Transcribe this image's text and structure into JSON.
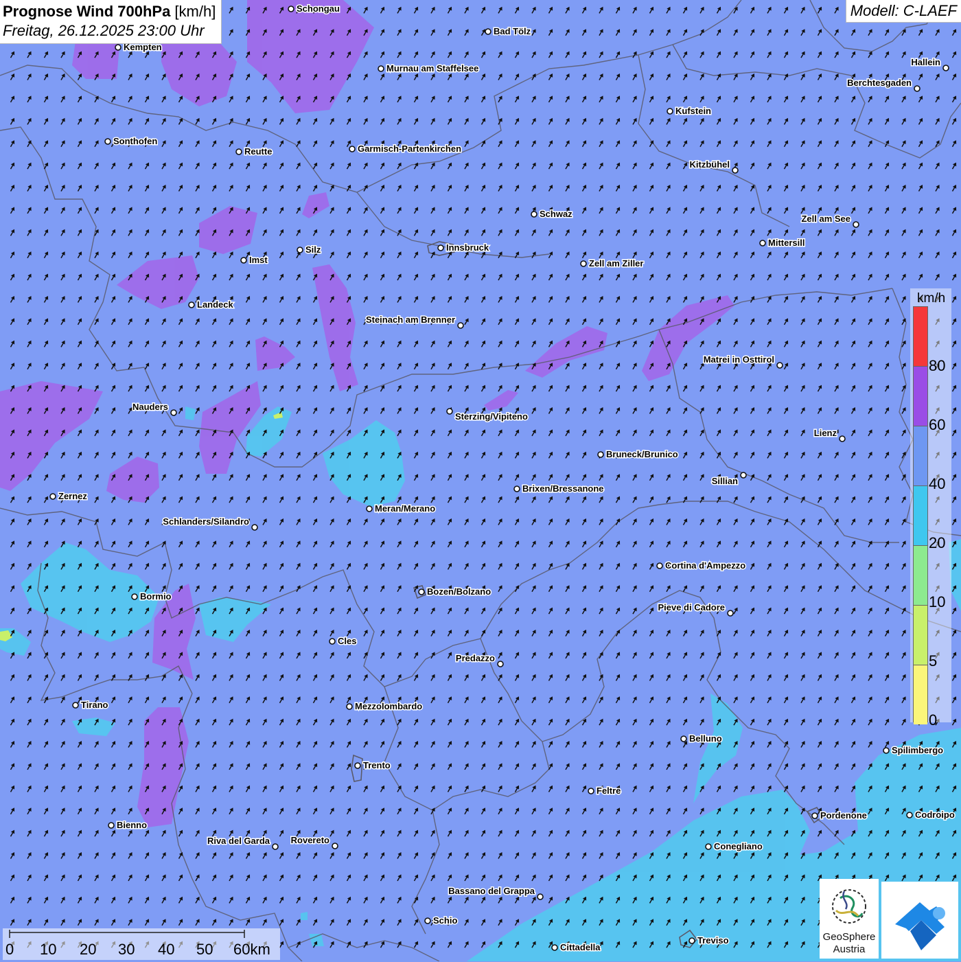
{
  "header": {
    "title_bold": "Prognose Wind 700hPa",
    "title_unit": " [km/h]",
    "datetime": "Freitag, 26.12.2025 23:00 Uhr"
  },
  "model": "Modell: C-LAEF",
  "legend": {
    "unit": "km/h",
    "steps": [
      {
        "label": "80",
        "color": "#F5383A"
      },
      {
        "label": "60",
        "color": "#9A4DE6"
      },
      {
        "label": "40",
        "color": "#6E97F2"
      },
      {
        "label": "20",
        "color": "#3FC7EF"
      },
      {
        "label": "10",
        "color": "#8DEA8F"
      },
      {
        "label": "5",
        "color": "#C9F06A"
      },
      {
        "label": "0",
        "color": "#FBF67A"
      }
    ]
  },
  "scale": {
    "labels": [
      "0",
      "10",
      "20",
      "30",
      "40",
      "50",
      "60km"
    ]
  },
  "logos": {
    "geosphere_name": "GeoSphere",
    "geosphere_sub": "Austria"
  },
  "colors": {
    "background": "#7F9CF5",
    "purple": "#9F6BEA",
    "cyan": "#55C6EF",
    "border": "#5a5a6a",
    "arrow": "#111111"
  },
  "wind": {
    "direction_deg": 300
  },
  "cities": [
    {
      "name": "Schongau"
    },
    {
      "name": "Kempten"
    },
    {
      "name": "Bad Tölz"
    },
    {
      "name": "Murnau am Staffelsee"
    },
    {
      "name": "Hallein"
    },
    {
      "name": "Berchtesgaden"
    },
    {
      "name": "Kufstein"
    },
    {
      "name": "Sonthofen"
    },
    {
      "name": "Reutte"
    },
    {
      "name": "Garmisch-Partenkirchen"
    },
    {
      "name": "Kitzbühel"
    },
    {
      "name": "Schwaz"
    },
    {
      "name": "Zell am See"
    },
    {
      "name": "Mittersill"
    },
    {
      "name": "Silz"
    },
    {
      "name": "Innsbruck"
    },
    {
      "name": "Imst"
    },
    {
      "name": "Zell am Ziller"
    },
    {
      "name": "Landeck"
    },
    {
      "name": "Steinach am Brenner"
    },
    {
      "name": "Matrei in Osttirol"
    },
    {
      "name": "Nauders"
    },
    {
      "name": "Sterzing/Vipiteno"
    },
    {
      "name": "Lienz"
    },
    {
      "name": "Bruneck/Brunico"
    },
    {
      "name": "Sillian"
    },
    {
      "name": "Zernez"
    },
    {
      "name": "Brixen/Bressanone"
    },
    {
      "name": "Meran/Merano"
    },
    {
      "name": "Schlanders/Silandro"
    },
    {
      "name": "Cortina d'Ampezzo"
    },
    {
      "name": "Bozen/Bolzano"
    },
    {
      "name": "Bormio"
    },
    {
      "name": "Pieve di Cadore"
    },
    {
      "name": "Cles"
    },
    {
      "name": "Predazzo"
    },
    {
      "name": "Tirano"
    },
    {
      "name": "Mezzolombardo"
    },
    {
      "name": "Belluno"
    },
    {
      "name": "Spilimbergo"
    },
    {
      "name": "Trento"
    },
    {
      "name": "Feltre"
    },
    {
      "name": "Pordenone"
    },
    {
      "name": "Codroipo"
    },
    {
      "name": "Bienno"
    },
    {
      "name": "Riva del Garda"
    },
    {
      "name": "Rovereto"
    },
    {
      "name": "Conegliano"
    },
    {
      "name": "Bassano del Grappa"
    },
    {
      "name": "Schio"
    },
    {
      "name": "Treviso"
    },
    {
      "name": "Cittadella"
    }
  ]
}
